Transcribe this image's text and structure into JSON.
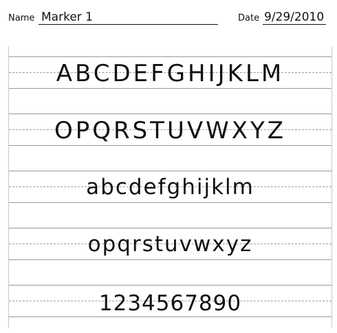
{
  "header": {
    "name_label": "Name",
    "name_value": "Marker 1",
    "date_label": "Date",
    "date_value": "9/29/2010"
  },
  "practice": {
    "rows": [
      "ABCDEFGHIJKLM",
      "OPQRSTUVWXYZ",
      "abcdefghijklm",
      "opqrstuvwxyz",
      "1234567890"
    ]
  }
}
